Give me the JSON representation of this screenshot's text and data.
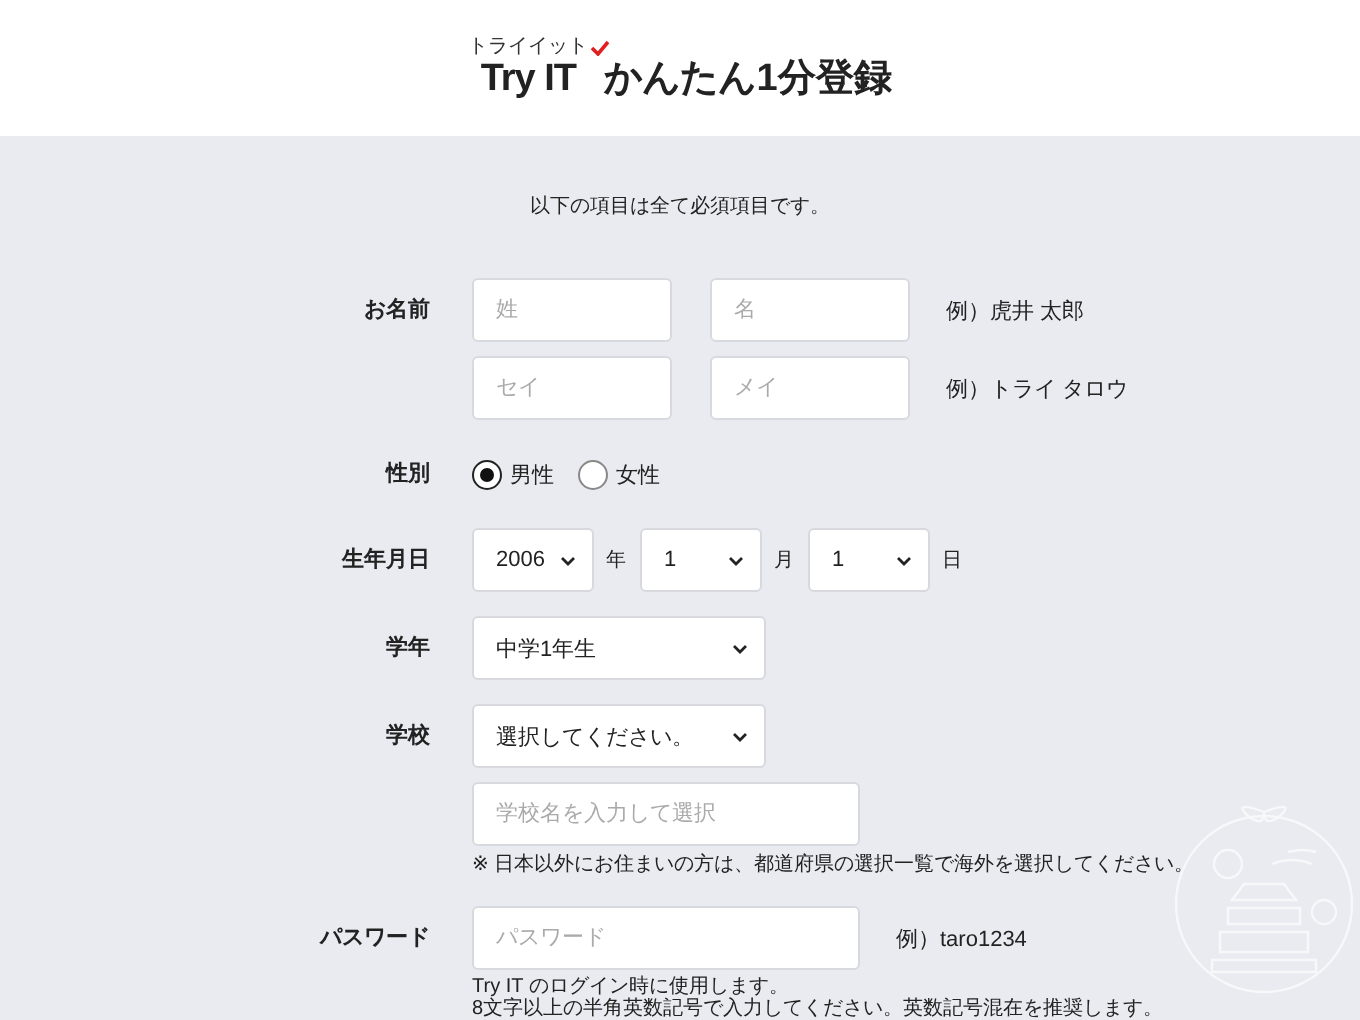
{
  "header": {
    "logo_ruby": "トライイット",
    "logo": "Try IT",
    "title": "かんたん1分登録"
  },
  "notice": "以下の項目は全て必須項目です。",
  "rows": [
    {
      "kind": "name",
      "label": "お名前",
      "lines": [
        {
          "fields": [
            {
              "placeholder": "姓"
            },
            {
              "placeholder": "名"
            }
          ],
          "example": "例）虎井 太郎"
        },
        {
          "fields": [
            {
              "placeholder": "セイ"
            },
            {
              "placeholder": "メイ"
            }
          ],
          "example": "例）トライ タロウ"
        }
      ]
    },
    {
      "kind": "radio",
      "label": "性別",
      "options": [
        {
          "label": "男性",
          "selected": true
        },
        {
          "label": "女性",
          "selected": false
        }
      ]
    },
    {
      "kind": "date",
      "label": "生年月日",
      "parts": [
        {
          "value": "2006",
          "unit": "年"
        },
        {
          "value": "1",
          "unit": "月"
        },
        {
          "value": "1",
          "unit": "日"
        }
      ]
    },
    {
      "kind": "select",
      "label": "学年",
      "value": "中学1年生"
    },
    {
      "kind": "school",
      "label": "学校",
      "value": "選択してください。",
      "placeholder": "学校名を入力して選択",
      "note": "※ 日本以外にお住まいの方は、都道府県の選択一覧で海外を選択してください。"
    },
    {
      "kind": "password",
      "label": "パスワード",
      "placeholder": "パスワード",
      "example": "例）taro1234",
      "notes": [
        "Try IT のログイン時に使用します。",
        "8文字以上の半角英数記号で入力してください。英数記号混在を推奨します。"
      ]
    }
  ]
}
